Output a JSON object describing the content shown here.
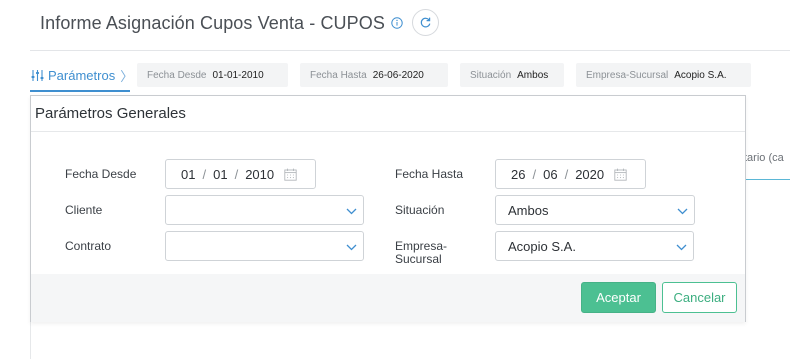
{
  "header": {
    "title": "Informe Asignación Cupos Venta - CUPOS"
  },
  "params_bar": {
    "link_label": "Parámetros",
    "chips": [
      {
        "key": "Fecha Desde",
        "value": "01-01-2010"
      },
      {
        "key": "Fecha Hasta",
        "value": "26-06-2020"
      },
      {
        "key": "Situación",
        "value": "Ambos"
      },
      {
        "key": "Empresa-Sucursal",
        "value": "Acopio S.A."
      }
    ]
  },
  "background": {
    "fragment_text": "tario (ca"
  },
  "panel": {
    "title": "Parámetros Generales",
    "fecha_desde": {
      "label": "Fecha Desde",
      "day": "01",
      "month": "01",
      "year": "2010",
      "sep": "/"
    },
    "fecha_hasta": {
      "label": "Fecha Hasta",
      "day": "26",
      "month": "06",
      "year": "2020",
      "sep": "/"
    },
    "cliente": {
      "label": "Cliente",
      "value": ""
    },
    "situacion": {
      "label": "Situación",
      "value": "Ambos"
    },
    "contrato": {
      "label": "Contrato",
      "value": ""
    },
    "empresa": {
      "label_line1": "Empresa-",
      "label_line2": "Sucursal",
      "value": "Acopio S.A."
    },
    "accept_label": "Aceptar",
    "cancel_label": "Cancelar"
  },
  "colors": {
    "accent_blue": "#3f8fd0",
    "accept_green": "#4cc092"
  }
}
